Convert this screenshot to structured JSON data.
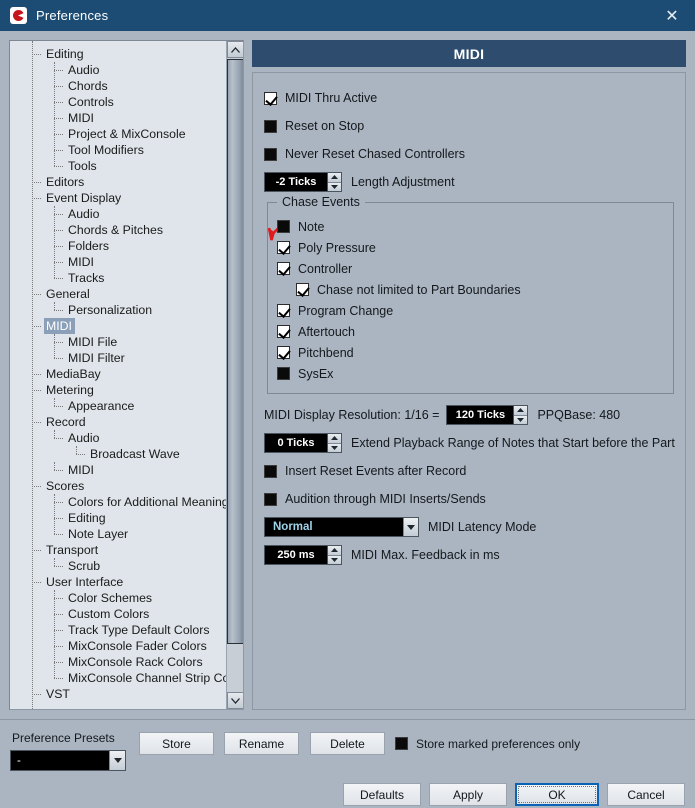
{
  "window": {
    "title": "Preferences",
    "app_icon": "cubase-logo-icon",
    "close_icon": "✕",
    "accent_titlebar": "#1c4b73",
    "panel_bg": "#abb5c1",
    "header_bg": "#2d4c6e"
  },
  "tree": {
    "selected": "MIDI",
    "items": [
      {
        "label": "Editing",
        "depth": 1
      },
      {
        "label": "Audio",
        "depth": 2
      },
      {
        "label": "Chords",
        "depth": 2
      },
      {
        "label": "Controls",
        "depth": 2
      },
      {
        "label": "MIDI",
        "depth": 2
      },
      {
        "label": "Project & MixConsole",
        "depth": 2
      },
      {
        "label": "Tool Modifiers",
        "depth": 2
      },
      {
        "label": "Tools",
        "depth": 2
      },
      {
        "label": "Editors",
        "depth": 1
      },
      {
        "label": "Event Display",
        "depth": 1
      },
      {
        "label": "Audio",
        "depth": 2
      },
      {
        "label": "Chords & Pitches",
        "depth": 2
      },
      {
        "label": "Folders",
        "depth": 2
      },
      {
        "label": "MIDI",
        "depth": 2
      },
      {
        "label": "Tracks",
        "depth": 2
      },
      {
        "label": "General",
        "depth": 1
      },
      {
        "label": "Personalization",
        "depth": 2
      },
      {
        "label": "MIDI",
        "depth": 1,
        "selected": true
      },
      {
        "label": "MIDI File",
        "depth": 2
      },
      {
        "label": "MIDI Filter",
        "depth": 2
      },
      {
        "label": "MediaBay",
        "depth": 1
      },
      {
        "label": "Metering",
        "depth": 1
      },
      {
        "label": "Appearance",
        "depth": 2
      },
      {
        "label": "Record",
        "depth": 1
      },
      {
        "label": "Audio",
        "depth": 2
      },
      {
        "label": "Broadcast Wave",
        "depth": 3
      },
      {
        "label": "MIDI",
        "depth": 2
      },
      {
        "label": "Scores",
        "depth": 1
      },
      {
        "label": "Colors for Additional Meanings",
        "depth": 2
      },
      {
        "label": "Editing",
        "depth": 2
      },
      {
        "label": "Note Layer",
        "depth": 2
      },
      {
        "label": "Transport",
        "depth": 1
      },
      {
        "label": "Scrub",
        "depth": 2
      },
      {
        "label": "User Interface",
        "depth": 1
      },
      {
        "label": "Color Schemes",
        "depth": 2
      },
      {
        "label": "Custom Colors",
        "depth": 2
      },
      {
        "label": "Track Type Default Colors",
        "depth": 2
      },
      {
        "label": "MixConsole Fader Colors",
        "depth": 2
      },
      {
        "label": "MixConsole Rack Colors",
        "depth": 2
      },
      {
        "label": "MixConsole Channel Strip Colors",
        "depth": 2
      },
      {
        "label": "VST",
        "depth": 1
      }
    ]
  },
  "panel": {
    "header_title": "MIDI",
    "checkboxes_top": [
      {
        "label": "MIDI Thru Active",
        "checked": true
      },
      {
        "label": "Reset on Stop",
        "checked": false
      },
      {
        "label": "Never Reset Chased Controllers",
        "checked": false
      }
    ],
    "length_adjustment": {
      "value": "-2 Ticks",
      "label": "Length Adjustment"
    },
    "chase_events": {
      "legend": "Chase Events",
      "items": [
        {
          "label": "Note",
          "checked": false,
          "indent": 0,
          "marked": true
        },
        {
          "label": "Poly Pressure",
          "checked": true,
          "indent": 0
        },
        {
          "label": "Controller",
          "checked": true,
          "indent": 0
        },
        {
          "label": "Chase not limited to Part Boundaries",
          "checked": true,
          "indent": 1
        },
        {
          "label": "Program Change",
          "checked": true,
          "indent": 0
        },
        {
          "label": "Aftertouch",
          "checked": true,
          "indent": 0
        },
        {
          "label": "Pitchbend",
          "checked": true,
          "indent": 0
        },
        {
          "label": "SysEx",
          "checked": false,
          "indent": 0
        }
      ]
    },
    "display_resolution": {
      "pre_label": "MIDI Display Resolution: 1/16 =",
      "value": "120 Ticks",
      "post_label": "PPQBase: 480"
    },
    "extend_playback": {
      "value": "0 Ticks",
      "label": "Extend Playback Range of Notes that Start before the Part"
    },
    "checkboxes_bottom": [
      {
        "label": "Insert Reset Events after Record",
        "checked": false
      },
      {
        "label": "Audition through MIDI Inserts/Sends",
        "checked": false
      }
    ],
    "latency_mode": {
      "value": "Normal",
      "label": "MIDI Latency Mode"
    },
    "max_feedback": {
      "value": "250 ms",
      "label": "MIDI Max. Feedback in ms"
    }
  },
  "footer": {
    "presets_label": "Preference Presets",
    "presets_value": "-",
    "store_label": "Store",
    "rename_label": "Rename",
    "delete_label": "Delete",
    "store_marked_label": "Store marked preferences only",
    "store_marked_checked": false,
    "defaults_label": "Defaults",
    "apply_label": "Apply",
    "ok_label": "OK",
    "cancel_label": "Cancel"
  }
}
